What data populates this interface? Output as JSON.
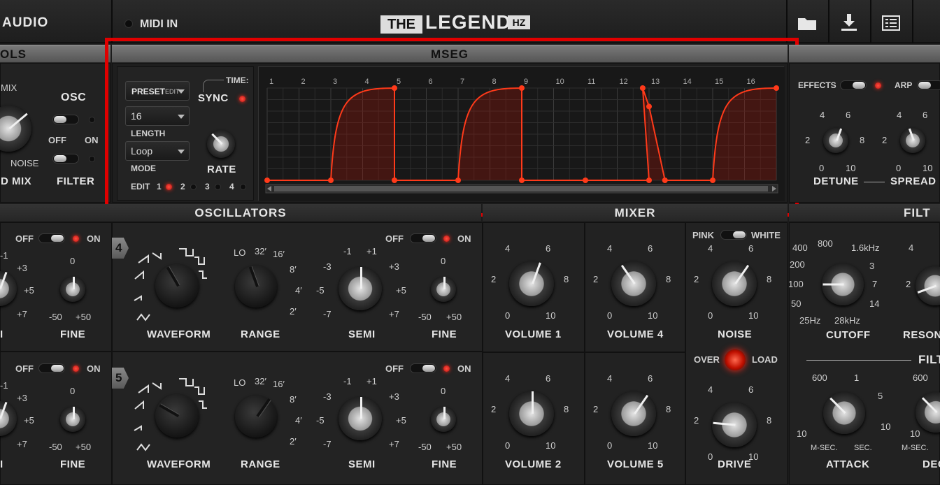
{
  "app": {
    "header_left": "AUDIO",
    "midi_in": "MIDI IN",
    "logo_the": "THE",
    "logo_legend": "LEGEND",
    "logo_hz": "HZ",
    "icons": [
      "folder-icon",
      "download-icon",
      "panel-icon"
    ]
  },
  "sections": {
    "controls": "OLS",
    "mseg": "MSEG",
    "oscillators": "OSCILLATORS",
    "mixer": "MIXER",
    "filter": "FILT",
    "filter_env": "FILT"
  },
  "controls": {
    "mix_label": "MIX",
    "noise_label": "NOISE",
    "mix_title": "D MIX",
    "osc_label": "OSC",
    "off": "OFF",
    "on": "ON",
    "filter_label": "FILTER"
  },
  "mseg": {
    "preset_label": "PRESET",
    "edit_small": "EDIT",
    "length_value": "16",
    "length_label": "LENGTH",
    "mode_value": "Loop",
    "mode_label": "MODE",
    "time_label": "TIME:",
    "sync_label": "SYNC",
    "rate_label": "RATE",
    "edit_label": "EDIT",
    "edit_slots": [
      "1",
      "2",
      "3",
      "4"
    ],
    "grid_numbers": [
      "1",
      "2",
      "3",
      "4",
      "5",
      "6",
      "7",
      "8",
      "9",
      "10",
      "11",
      "12",
      "13",
      "14",
      "15",
      "16"
    ],
    "points": [
      {
        "x": 0.0,
        "y": 0
      },
      {
        "x": 2.0,
        "y": 0
      },
      {
        "x": 4.0,
        "y": 1
      },
      {
        "x": 4.0,
        "y": 0
      },
      {
        "x": 6.0,
        "y": 0
      },
      {
        "x": 8.0,
        "y": 1
      },
      {
        "x": 8.0,
        "y": 0
      },
      {
        "x": 10.0,
        "y": 0
      },
      {
        "x": 12.0,
        "y": 0
      },
      {
        "x": 11.8,
        "y": 1
      },
      {
        "x": 12.0,
        "y": 0.8
      },
      {
        "x": 12.5,
        "y": 0
      },
      {
        "x": 14.0,
        "y": 0
      },
      {
        "x": 16.0,
        "y": 1
      }
    ]
  },
  "right_controls": {
    "effects": "EFFECTS",
    "arp": "ARP",
    "detune_label": "DETUNE",
    "spread_label": "SPREAD",
    "scale": [
      "4",
      "6",
      "2",
      "8",
      "0",
      "10"
    ]
  },
  "oscillators": {
    "off": "OFF",
    "on": "ON",
    "osc4_num": "4",
    "osc5_num": "5",
    "waveform": "WAVEFORM",
    "range": "RANGE",
    "semi": "SEMI",
    "fine": "FINE",
    "range_ticks": [
      "LO",
      "32′",
      "16′",
      "8′",
      "4′",
      "2′"
    ],
    "semi_ticks": [
      "-1",
      "+1",
      "-3",
      "+3",
      "-5",
      "+5",
      "-7",
      "+7"
    ],
    "fine_ticks": [
      "0",
      "-50",
      "+50"
    ],
    "left_semi_ticks": [
      "-1",
      "+3",
      "+5",
      "+7"
    ],
    "left_semi_label": "I",
    "left_fine_label": "FINE"
  },
  "mixer": {
    "volume1": "VOLUME 1",
    "volume4": "VOLUME 4",
    "volume2": "VOLUME 2",
    "volume5": "VOLUME 5",
    "noise": "NOISE",
    "drive": "DRIVE",
    "pink": "PINK",
    "white": "WHITE",
    "over": "OVER",
    "load": "LOAD",
    "scale": [
      "4",
      "6",
      "2",
      "8",
      "0",
      "10"
    ]
  },
  "filter": {
    "cutoff": "CUTOFF",
    "reson": "RESON",
    "attack": "ATTACK",
    "dec": "DEC",
    "cutoff_ticks": [
      "400",
      "800",
      "1.6kHz",
      "200",
      "3",
      "100",
      "7",
      "50",
      "14",
      "25Hz",
      "28kHz"
    ],
    "attack_ticks": [
      "600",
      "1",
      "5",
      "10",
      "10",
      "M-SEC.",
      "SEC."
    ],
    "dec_ticks": [
      "600",
      "10",
      "M-SEC."
    ],
    "reson_ticks": [
      "4",
      "2"
    ]
  }
}
